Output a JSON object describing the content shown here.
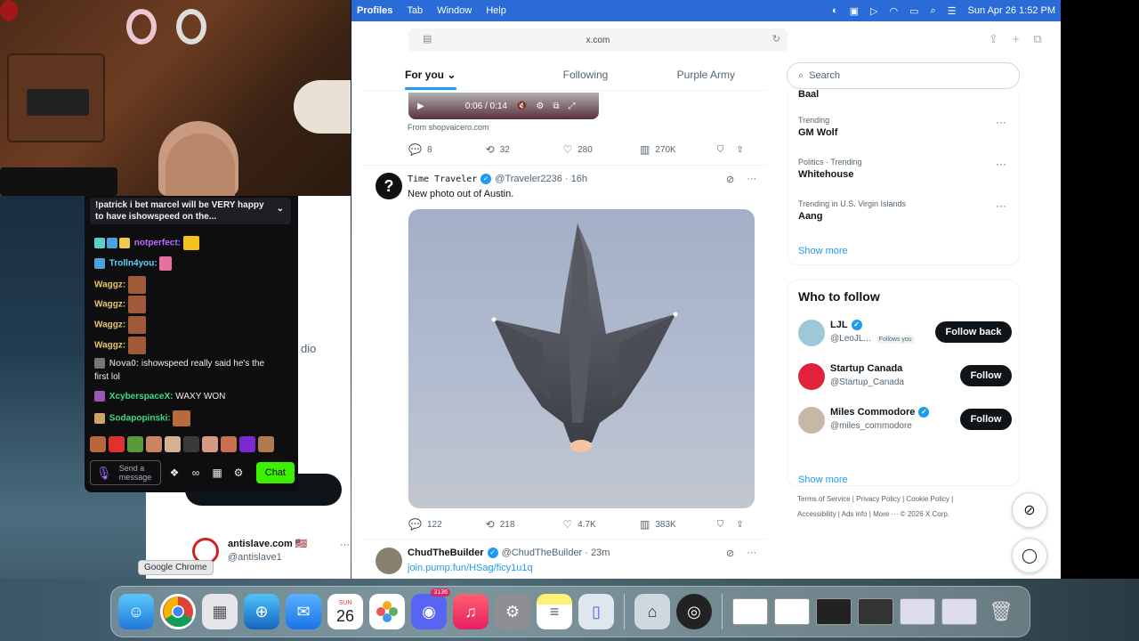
{
  "menubar": {
    "app_menus": [
      "Profiles",
      "Tab",
      "Window",
      "Help"
    ],
    "datetime": "Sun Apr 26  1:52 PM"
  },
  "browser": {
    "url": "x.com"
  },
  "chat": {
    "pinned": "!patrick i bet marcel will be VERY happy to have ishowspeed on the...",
    "messages": [
      {
        "user": "notperfect:",
        "color": "#b96cff",
        "text": ""
      },
      {
        "user": "Trolln4you:",
        "color": "#5bd4ff",
        "text": ""
      },
      {
        "user": "Waggz:",
        "color": "#e9c56a",
        "text": ""
      },
      {
        "user": "Waggz:",
        "color": "#e9c56a",
        "text": ""
      },
      {
        "user": "Waggz:",
        "color": "#e9c56a",
        "text": ""
      },
      {
        "user": "Waggz:",
        "color": "#e9c56a",
        "text": ""
      },
      {
        "user": "Nova0:",
        "color": "#b8b8b8",
        "text": "ishowspeed really said he's the"
      },
      {
        "user": "XcyberspaceX:",
        "color": "#3ddc84",
        "text": "WAXY WON"
      },
      {
        "user": "Sodapopinski:",
        "color": "#3ddc84",
        "text": ""
      }
    ],
    "nova_cont": "first lol",
    "input_placeholder": "Send a message",
    "chat_button": "Chat"
  },
  "bgwin": {
    "partial_text": "dio",
    "post_name": "antislave.com 🇺🇸",
    "post_handle": "@antislave1",
    "tooltip": "Google Chrome"
  },
  "tabs": [
    {
      "label": "For you ⌄"
    },
    {
      "label": "Following"
    },
    {
      "label": "Purple Army"
    }
  ],
  "video": {
    "time": "0:06 / 0:14",
    "from": "From shopvaicero.com"
  },
  "post1_stats": {
    "replies": "8",
    "reposts": "32",
    "likes": "280",
    "views": "270K"
  },
  "post2": {
    "name": "Time Traveler",
    "handle": "@Traveler2236 · 16h",
    "text": "New photo out of Austin.",
    "avatar": "?",
    "replies": "122",
    "reposts": "218",
    "likes": "4.7K",
    "views": "383K"
  },
  "post3": {
    "name": "ChudTheBuilder",
    "handle": "@ChudTheBuilder · 23m",
    "link": "join.pump.fun/HSag/ficy1u1q"
  },
  "search": {
    "placeholder": "Search"
  },
  "trends": {
    "partial": "Baal",
    "items": [
      {
        "context": "Trending",
        "name": "GM Wolf"
      },
      {
        "context": "Politics · Trending",
        "name": "Whitehouse"
      },
      {
        "context": "Trending in U.S. Virgin Islands",
        "name": "Aang"
      }
    ],
    "show_more": "Show more"
  },
  "who_to_follow": {
    "title": "Who to follow",
    "users": [
      {
        "name": "LJL",
        "handle": "@LeoJL...",
        "follows_you": "Follows you",
        "button": "Follow back"
      },
      {
        "name": "Startup Canada",
        "handle": "@Startup_Canada",
        "button": "Follow"
      },
      {
        "name": "Miles Commodore",
        "handle": "@miles_commodore",
        "button": "Follow"
      }
    ],
    "show_more": "Show more"
  },
  "footer": {
    "line1": "Terms of Service  |  Privacy Policy  |  Cookie Policy  |",
    "line2": "Accessibility  |  Ads info  |  More ···  © 2026 X Corp."
  },
  "dock": {
    "calendar_month": "SUN",
    "calendar_day": "26",
    "discord_badge": "3136"
  }
}
